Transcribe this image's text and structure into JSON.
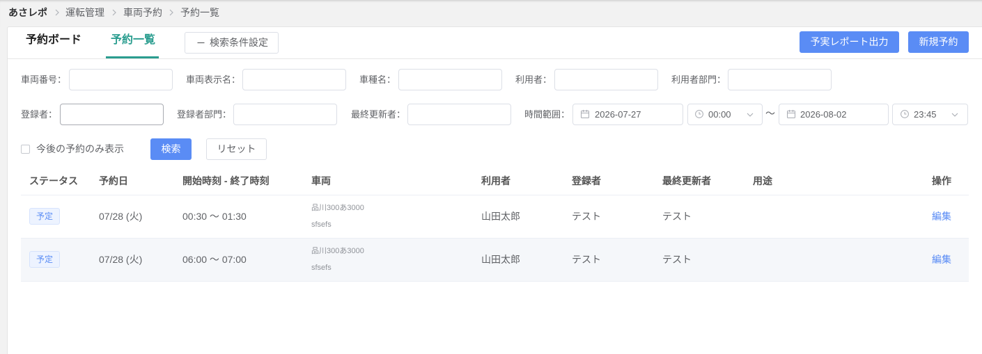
{
  "breadcrumb": [
    "あさレポ",
    "運転管理",
    "車両予約",
    "予約一覧"
  ],
  "tabs": [
    {
      "label": "予約ボード",
      "active": false
    },
    {
      "label": "予約一覧",
      "active": true
    }
  ],
  "filter_toggle": {
    "label": "検索条件設定",
    "icon": "minus-icon"
  },
  "header_actions": {
    "report_export": "予実レポート出力",
    "new_reservation": "新規予約"
  },
  "filters": {
    "vehicle_number": {
      "label": "車両番号：",
      "value": ""
    },
    "vehicle_display_name": {
      "label": "車両表示名：",
      "value": ""
    },
    "vehicle_type_name": {
      "label": "車種名：",
      "value": ""
    },
    "user": {
      "label": "利用者：",
      "value": ""
    },
    "user_department": {
      "label": "利用者部門：",
      "value": ""
    },
    "registrant": {
      "label": "登録者：",
      "value": ""
    },
    "registrant_department": {
      "label": "登録者部門：",
      "value": ""
    },
    "last_updater": {
      "label": "最終更新者：",
      "value": ""
    },
    "time_range": {
      "label": "時間範囲：",
      "start_date": "2026-07-27",
      "start_time": "00:00",
      "separator": "〜",
      "end_date": "2026-08-02",
      "end_time": "23:45"
    },
    "future_only": {
      "label": "今後の予約のみ表示",
      "checked": false
    },
    "search_button": "検索",
    "reset_button": "リセット"
  },
  "table": {
    "columns": [
      "ステータス",
      "予約日",
      "開始時刻 - 終了時刻",
      "車両",
      "利用者",
      "登録者",
      "最終更新者",
      "用途",
      "操作"
    ],
    "rows": [
      {
        "status": "予定",
        "date": "07/28 (火)",
        "time": "00:30 〜 01:30",
        "vehicle_plate": "品川300あ3000",
        "vehicle_name": "sfsefs",
        "user": "山田太郎",
        "registrant": "テスト",
        "last_updater": "テスト",
        "purpose": "",
        "action": "編集"
      },
      {
        "status": "予定",
        "date": "07/28 (火)",
        "time": "06:00 〜 07:00",
        "vehicle_plate": "品川300あ3000",
        "vehicle_name": "sfsefs",
        "user": "山田太郎",
        "registrant": "テスト",
        "last_updater": "テスト",
        "purpose": "",
        "action": "編集"
      }
    ]
  },
  "icons": {
    "breadcrumb_separator": "chevron-right-icon",
    "date_field": "calendar-icon",
    "time_field": "clock-icon",
    "select_arrow": "chevron-down-icon"
  },
  "colors": {
    "primary": "#5a8cf5",
    "active_tab": "#2a9d8f",
    "row_hover_bg": "#f5f7fa"
  }
}
